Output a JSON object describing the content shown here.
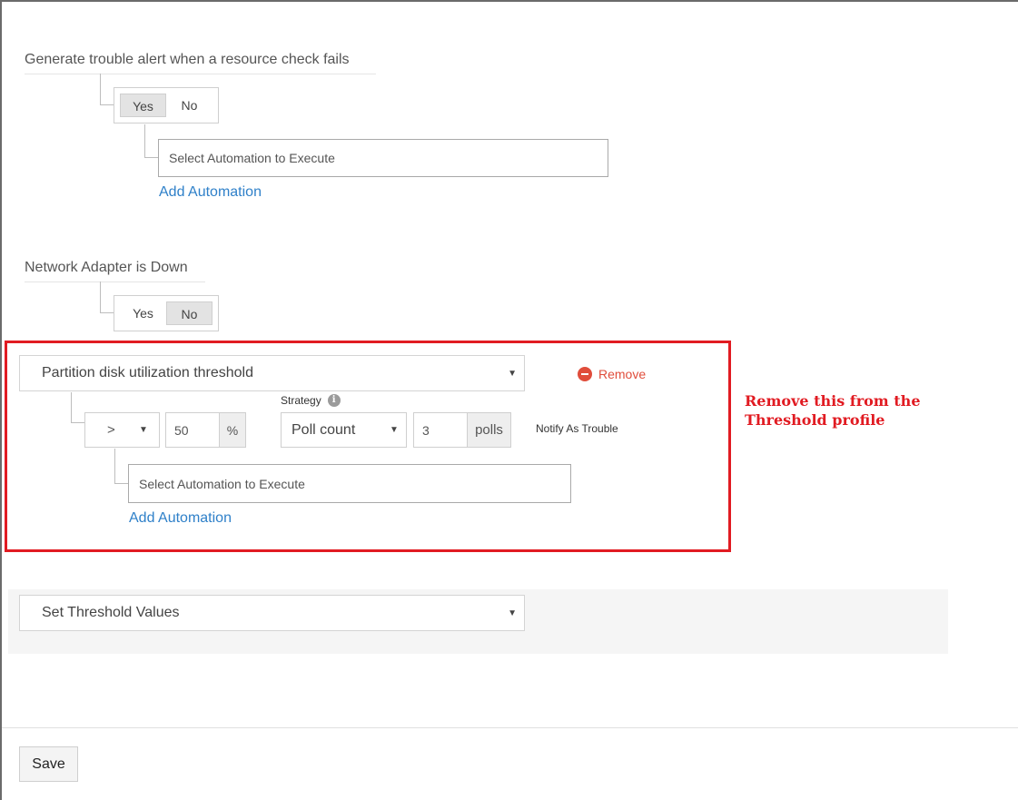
{
  "trouble_alert": {
    "label": "Generate trouble alert when a resource check fails",
    "yes_label": "Yes",
    "no_label": "No",
    "selected": "Yes",
    "automation_placeholder": "Select Automation to Execute",
    "add_automation_label": "Add Automation"
  },
  "network_adapter": {
    "label": "Network Adapter is Down",
    "yes_label": "Yes",
    "no_label": "No",
    "selected": "No"
  },
  "partition_threshold": {
    "selected_attribute": "Partition disk utilization threshold",
    "remove_label": "Remove",
    "operator": ">",
    "value": "50",
    "unit": "%",
    "strategy_label": "Strategy",
    "strategy_value": "Poll count",
    "polls_value": "3",
    "polls_unit": "polls",
    "notify_label": "Notify As Trouble",
    "automation_placeholder": "Select Automation to Execute",
    "add_automation_label": "Add Automation"
  },
  "annotation": {
    "line1": "Remove this from the",
    "line2": "Threshold profile"
  },
  "threshold_select": {
    "placeholder": "Set Threshold Values"
  },
  "footer": {
    "save_label": "Save"
  },
  "colors": {
    "link": "#2f80c9",
    "highlight": "#e11b22",
    "remove": "#e04d3b"
  }
}
